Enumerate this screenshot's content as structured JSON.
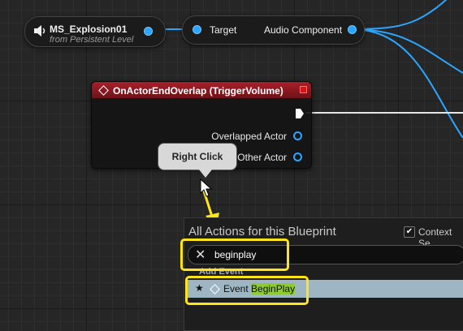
{
  "var_node": {
    "name": "MS_Explosion01",
    "subtitle": "from Persistent Level",
    "icon": "speaker-icon"
  },
  "target_node": {
    "input_label": "Target",
    "output_label": "Audio Component"
  },
  "event_node": {
    "title": "OnActorEndOverlap (TriggerVolume)",
    "pins": [
      "Overlapped Actor",
      "Other Actor"
    ]
  },
  "tooltip": {
    "text": "Right Click"
  },
  "action_menu": {
    "title": "All Actions for this Blueprint",
    "context_label": "Context Se",
    "context_checked": true,
    "search_value": "beginplay",
    "category": "Add Event",
    "result_prefix": "Event ",
    "result_match": "BeginPlay"
  },
  "colors": {
    "pin_blue": "#2aa6ff",
    "event_header": "#a8202a",
    "highlight_yellow": "#ffe41a",
    "match_green": "#8ccb34",
    "selection": "#9eb6c4"
  }
}
